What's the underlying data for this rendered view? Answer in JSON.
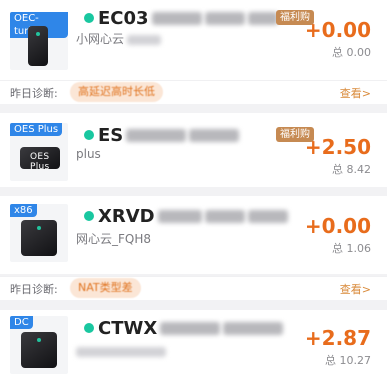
{
  "devices": [
    {
      "tag": "OEC-turbo",
      "name": "EC03",
      "subtitle": "小网心云",
      "badge": "福利购",
      "amount": "+0.00",
      "total": "总 0.00"
    },
    {
      "tag": "OES Plus",
      "name": "ES",
      "subtitle": "plus",
      "badge": "福利购",
      "amount": "+2.50",
      "total": "总 8.42",
      "box_label": "OES Plus"
    },
    {
      "tag": "x86",
      "name": "XRVD",
      "subtitle": "网心云_FQH8",
      "badge": "",
      "amount": "+0.00",
      "total": "总 1.06"
    },
    {
      "tag": "DC",
      "name": "CTWX",
      "subtitle": "",
      "badge": "",
      "amount": "+2.87",
      "total": "总 10.27"
    }
  ],
  "diagnostics": [
    {
      "label": "昨日诊断:",
      "message": "高延迟高时长低",
      "link": "查看>"
    },
    {
      "label": "昨日诊断:",
      "message": "NAT类型差",
      "link": "查看>"
    }
  ],
  "colors": {
    "accent": "#e86c1c",
    "online": "#19c7a0",
    "tag": "#2f86e8",
    "badge": "#c68a52"
  }
}
